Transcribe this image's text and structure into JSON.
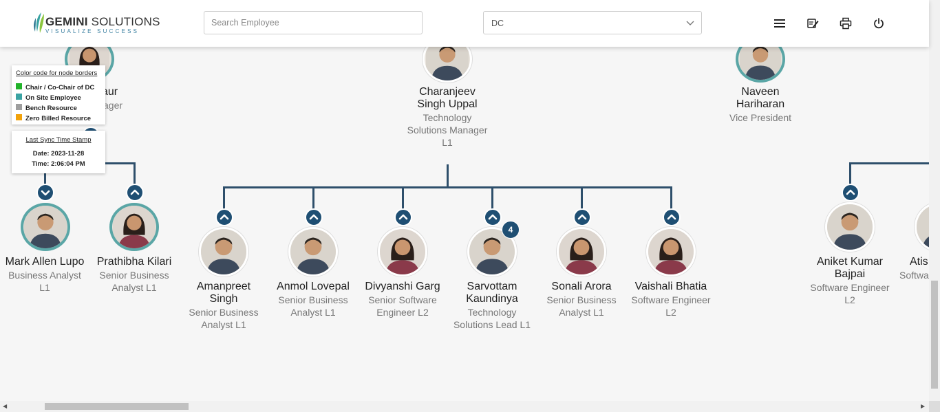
{
  "header": {
    "logo_name_bold": "GEMINI",
    "logo_name_rest": " SOLUTIONS",
    "logo_tagline": "VISUALIZE SUCCESS",
    "search_placeholder": "Search Employee",
    "department_selected": "DC",
    "icons": [
      "menu-icon",
      "edit-note-icon",
      "print-icon",
      "power-icon"
    ]
  },
  "legend": {
    "title": "Color code for node borders",
    "items": [
      {
        "label": "Chair / Co-Chair of DC",
        "color": "#22b32a"
      },
      {
        "label": "On Site Employee",
        "color": "#3aa3a3"
      },
      {
        "label": "Bench Resource",
        "color": "#9e9e9e"
      },
      {
        "label": "Zero Billed Resource",
        "color": "#f2a20a"
      }
    ]
  },
  "sync": {
    "title": "Last Sync Time Stamp",
    "date": "Date: 2023-11-28",
    "time": "Time: 2:06:04 PM"
  },
  "top_nodes": [
    {
      "name_partial": "aur",
      "role_partial": "ager"
    },
    {
      "name_line1": "Charanjeev",
      "name_line2": "Singh Uppal",
      "role_line1": "Technology",
      "role_line2": "Solutions Manager",
      "role_line3": "L1"
    },
    {
      "name_line1": "Naveen",
      "name_line2": "Hariharan",
      "role_line1": "Vice President"
    }
  ],
  "left_children": [
    {
      "name": "Mark Allen Lupo",
      "role_line1": "Business Analyst",
      "role_line2": "L1"
    },
    {
      "name": "Prathibha Kilari",
      "role_line1": "Senior Business",
      "role_line2": "Analyst L1"
    }
  ],
  "center_children": [
    {
      "name_line1": "Amanpreet",
      "name_line2": "Singh",
      "role_line1": "Senior Business",
      "role_line2": "Analyst L1"
    },
    {
      "name_line1": "Anmol Lovepal",
      "role_line1": "Senior Business",
      "role_line2": "Analyst L1"
    },
    {
      "name_line1": "Divyanshi Garg",
      "role_line1": "Senior Software",
      "role_line2": "Engineer L2"
    },
    {
      "name_line1": "Sarvottam",
      "name_line2": "Kaundinya",
      "role_line1": "Technology",
      "role_line2": "Solutions Lead L1",
      "badge": "4"
    },
    {
      "name_line1": "Sonali Arora",
      "role_line1": "Senior Business",
      "role_line2": "Analyst L1"
    },
    {
      "name_line1": "Vaishali Bhatia",
      "role_line1": "Software Engineer",
      "role_line2": "L2"
    }
  ],
  "right_children": [
    {
      "name_line1": "Aniket Kumar",
      "name_line2": "Bajpai",
      "role_line1": "Software Engineer",
      "role_line2": "L2"
    },
    {
      "name_partial": "Atis",
      "role_partial": "Softwa"
    }
  ]
}
